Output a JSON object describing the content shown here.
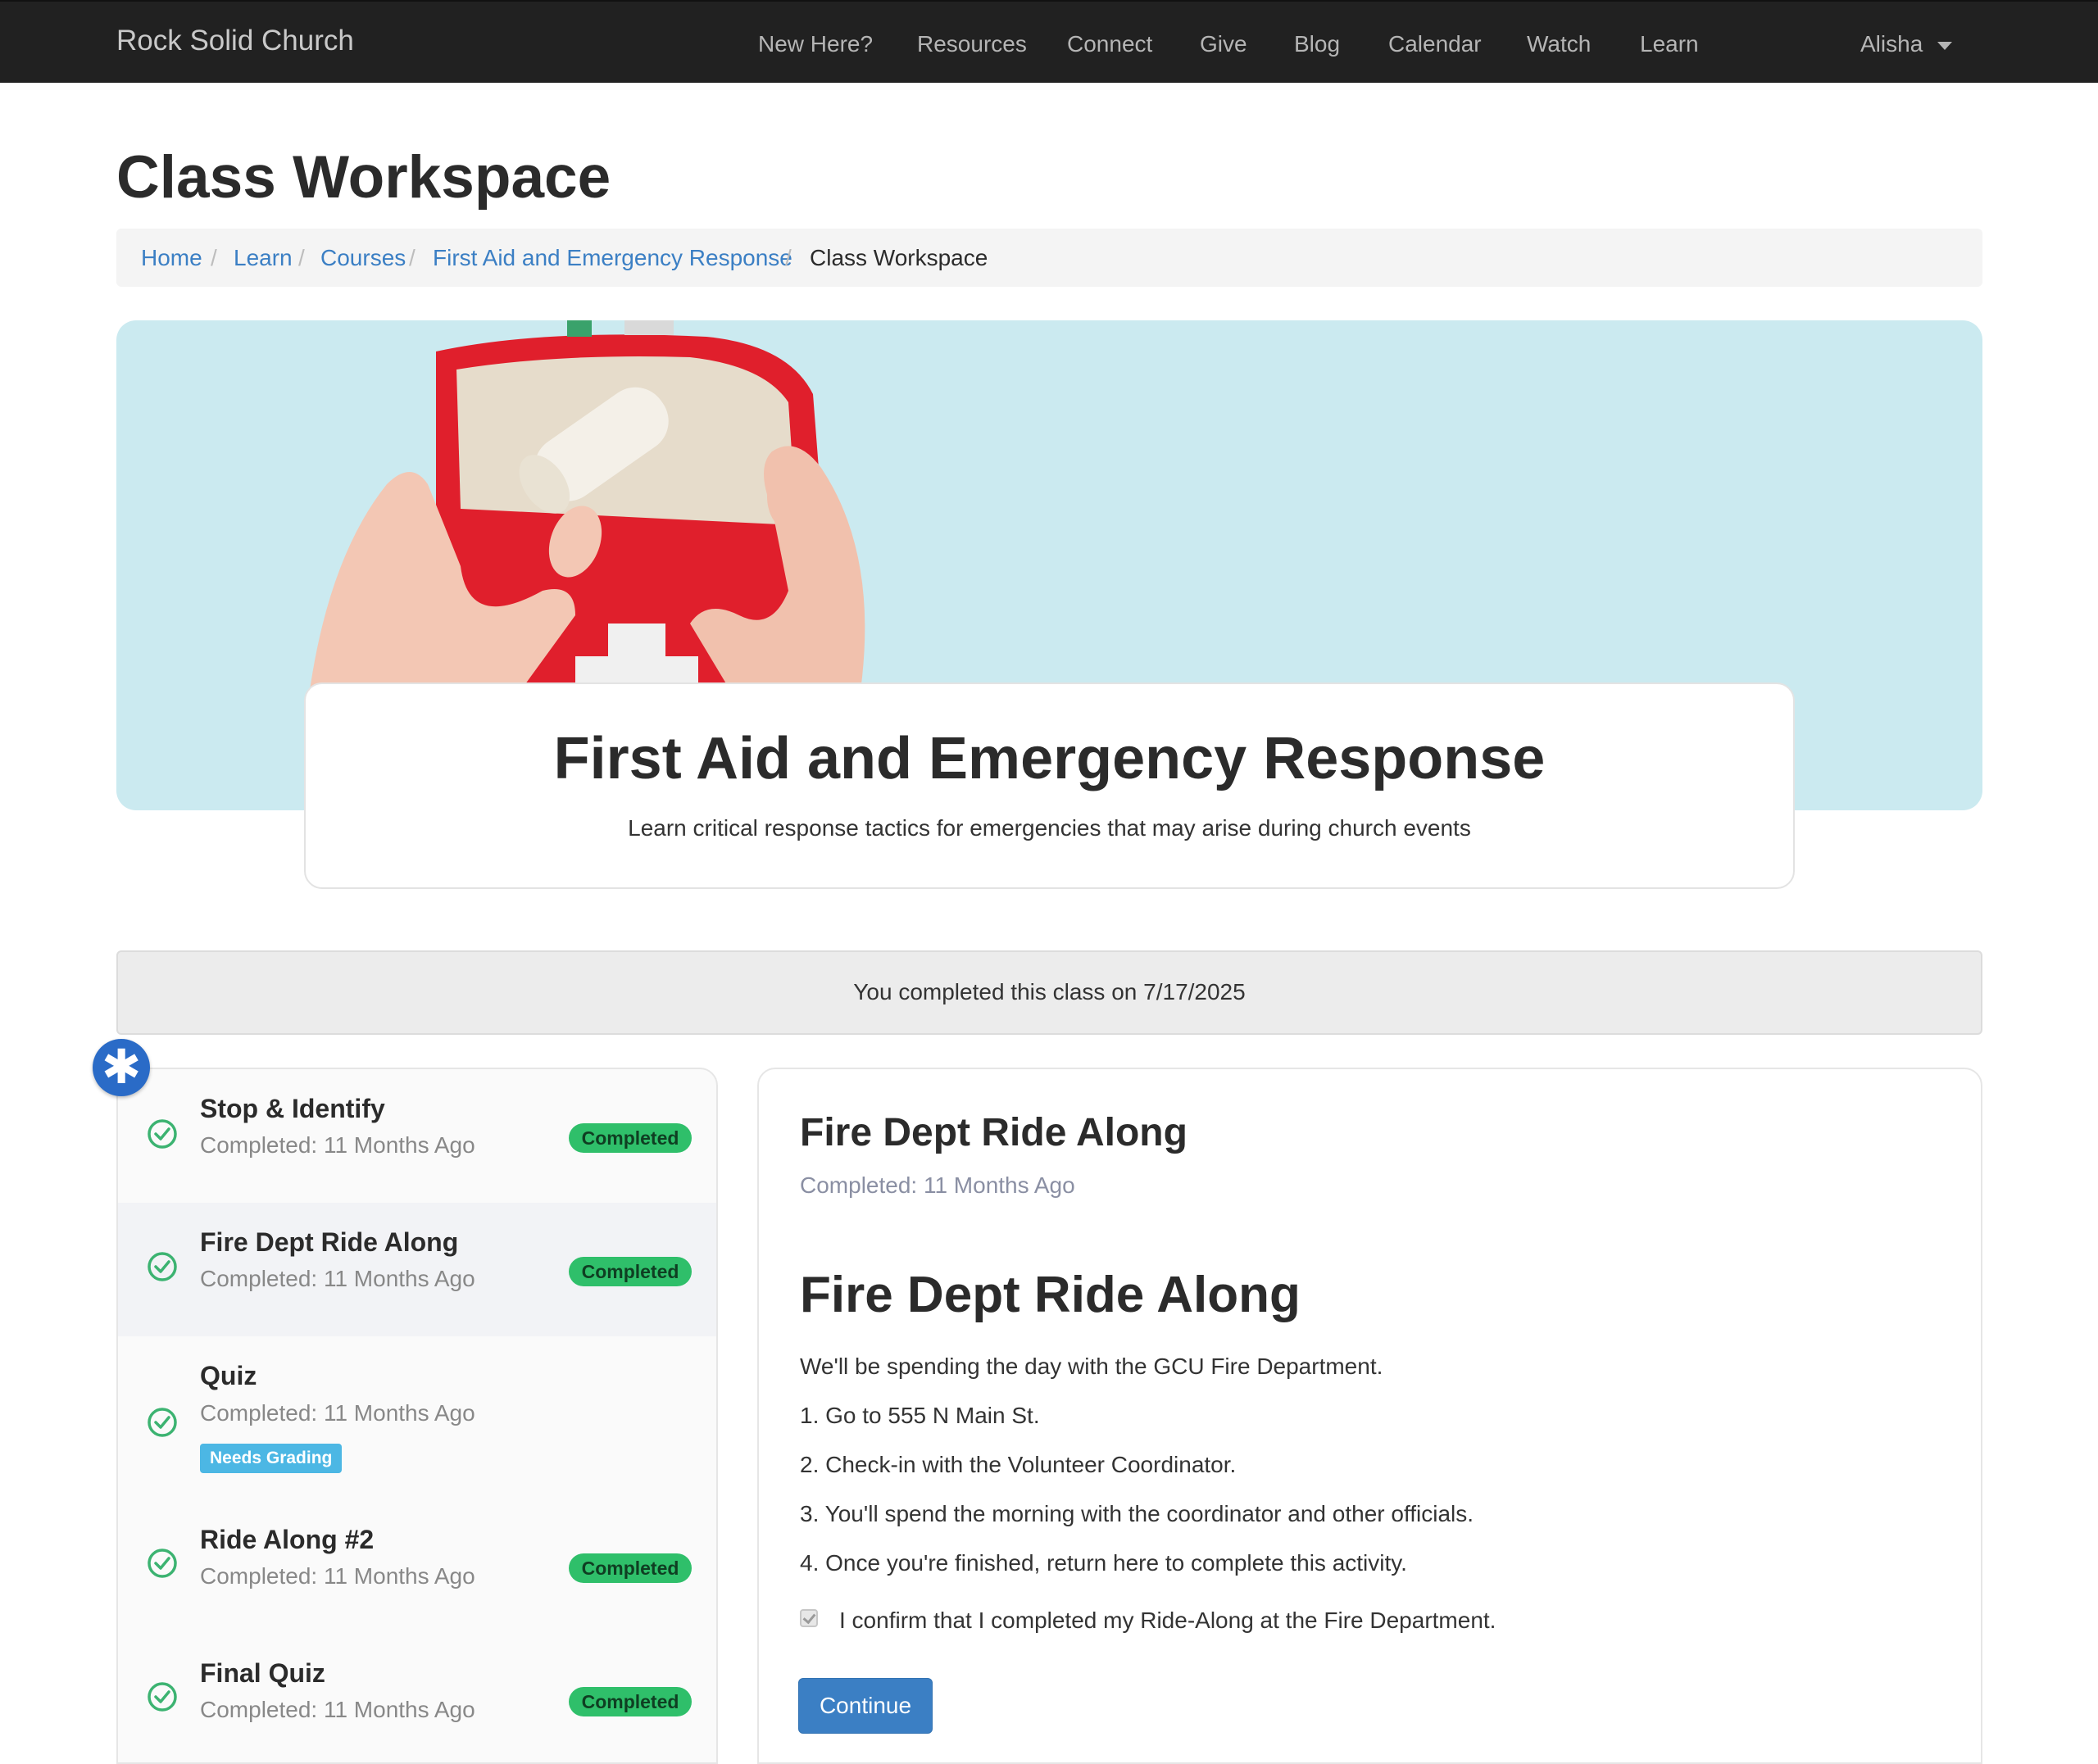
{
  "navbar": {
    "brand": "Rock Solid Church",
    "links": [
      "New Here?",
      "Resources",
      "Connect",
      "Give",
      "Blog",
      "Calendar",
      "Watch",
      "Learn"
    ],
    "user": "Alisha"
  },
  "page": {
    "title": "Class Workspace",
    "breadcrumb": [
      "Home",
      "Learn",
      "Courses",
      "First Aid and Emergency Response",
      "Class Workspace"
    ]
  },
  "course": {
    "title": "First Aid and Emergency Response",
    "description": "Learn critical response tactics for emergencies that may arise during church events",
    "completion_message": "You completed this class on 7/17/2025"
  },
  "activities": [
    {
      "title": "Stop & Identify",
      "subtitle": "Completed: 11 Months Ago",
      "badge": "Completed",
      "active": false
    },
    {
      "title": "Fire Dept Ride Along",
      "subtitle": "Completed: 11 Months Ago",
      "badge": "Completed",
      "active": true
    },
    {
      "title": "Quiz",
      "subtitle": "Completed: 11 Months Ago",
      "badge": "Needs Grading",
      "active": false
    },
    {
      "title": "Ride Along #2",
      "subtitle": "Completed: 11 Months Ago",
      "badge": "Completed",
      "active": false
    },
    {
      "title": "Final Quiz",
      "subtitle": "Completed: 11 Months Ago",
      "badge": "Completed",
      "active": false
    }
  ],
  "detail": {
    "title": "Fire Dept Ride Along",
    "subtitle": "Completed: 11 Months Ago",
    "heading": "Fire Dept Ride Along",
    "paragraphs": [
      "We'll be spending the day with the GCU Fire Department.",
      "1. Go to 555 N Main St.",
      "2. Check-in with the Volunteer Coordinator.",
      "3. You'll spend the morning with the coordinator and other officials.",
      "4. Once you're finished, return here to complete this activity."
    ],
    "confirm_label": "I confirm that I completed my Ride-Along at the Fire Department.",
    "confirm_checked": true,
    "continue_label": "Continue"
  },
  "colors": {
    "navbar_bg": "#212121",
    "link": "#3b7fc4",
    "success": "#2fbf6a",
    "info": "#4cb7e4",
    "primary": "#3b7fc4"
  },
  "icons": {
    "activity_status": "check-circle-icon",
    "floating": "asterisk-icon"
  }
}
